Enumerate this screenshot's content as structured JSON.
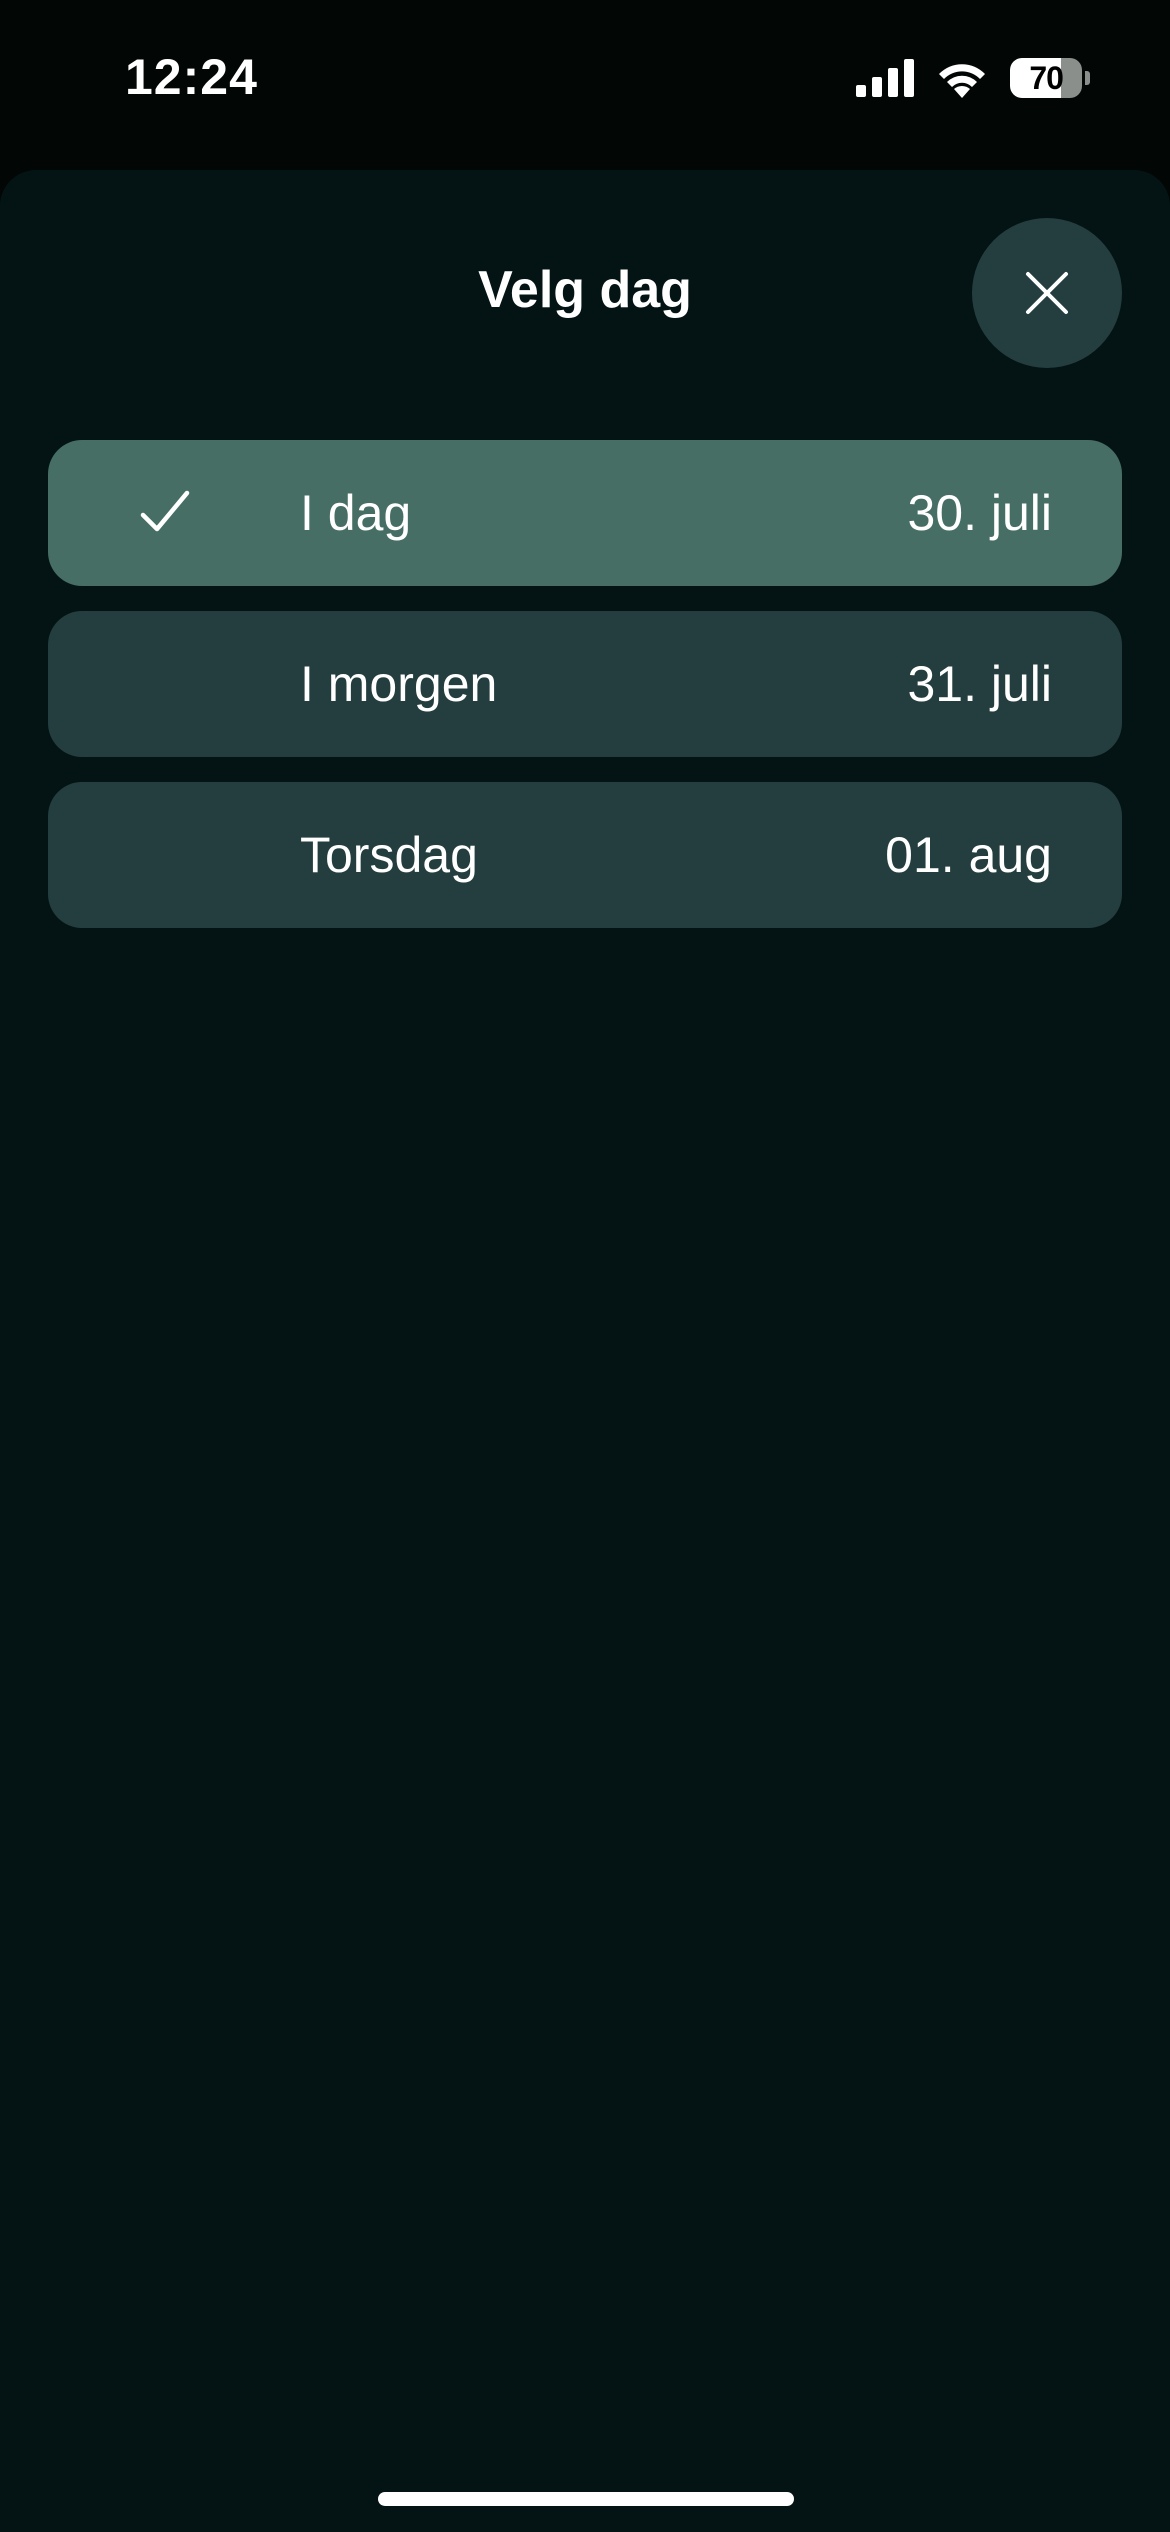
{
  "status_bar": {
    "time": "12:24",
    "battery_level": "70",
    "battery_fraction": 0.7,
    "icons": [
      "signal-icon",
      "wifi-icon",
      "battery-icon"
    ]
  },
  "sheet": {
    "title": "Velg dag",
    "close_icon": "close-icon"
  },
  "days": [
    {
      "label": "I dag",
      "date": "30. juli",
      "selected": true
    },
    {
      "label": "I morgen",
      "date": "31. juli",
      "selected": false
    },
    {
      "label": "Torsdag",
      "date": "01. aug",
      "selected": false
    }
  ],
  "colors": {
    "background": "#020604",
    "sheet": "#041414",
    "item": "#243e3f",
    "item_selected": "#466e65",
    "text": "#ffffff"
  }
}
